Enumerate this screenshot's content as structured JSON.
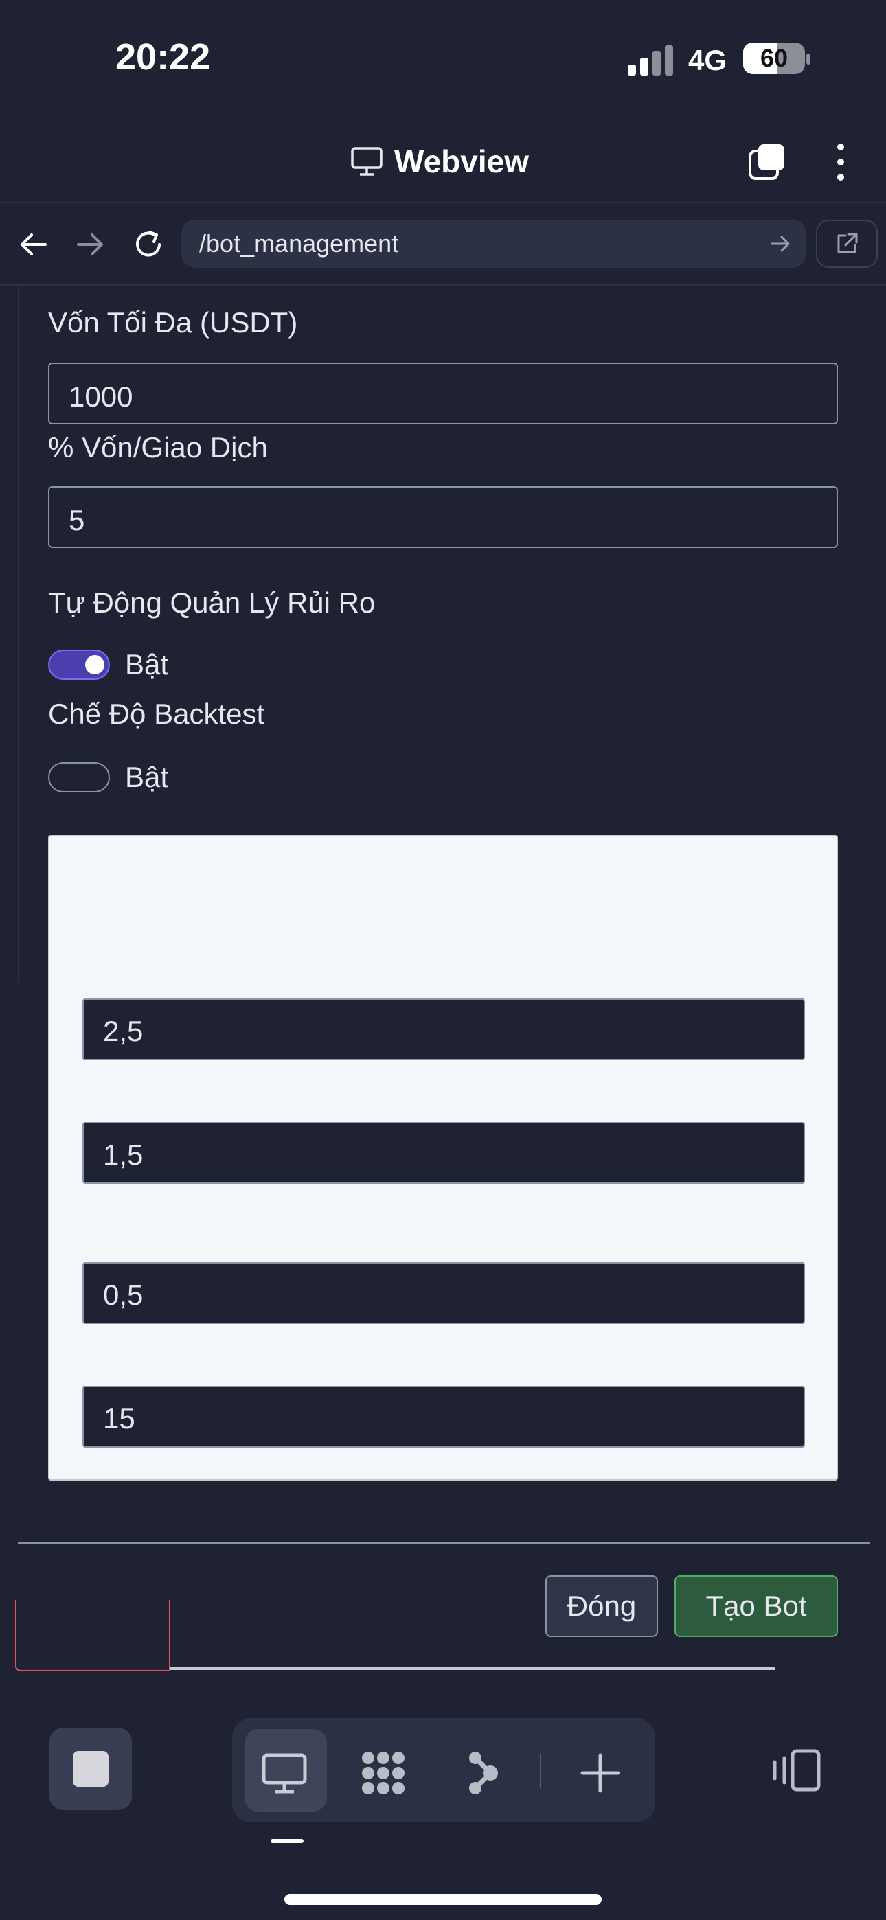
{
  "status_bar": {
    "time": "20:22",
    "network": "4G",
    "battery": "60",
    "battery_level": 0.6
  },
  "header": {
    "title": "Webview"
  },
  "url_bar": {
    "url": "/bot_management"
  },
  "form": {
    "max_capital_label": "Vốn Tối Đa (USDT)",
    "max_capital_value": "1000",
    "capital_per_trade_label": "% Vốn/Giao Dịch",
    "capital_per_trade_value": "5",
    "auto_risk_label": "Tự Động Quản Lý Rủi Ro",
    "auto_risk_toggle_label": "Bật",
    "auto_risk_enabled": true,
    "backtest_label": "Chế Độ Backtest",
    "backtest_toggle_label": "Bật",
    "backtest_enabled": false,
    "risk_fields": [
      "2,5",
      "1,5",
      "0,5",
      "15"
    ]
  },
  "footer": {
    "close_label": "Đóng",
    "create_label": "Tạo Bot"
  }
}
